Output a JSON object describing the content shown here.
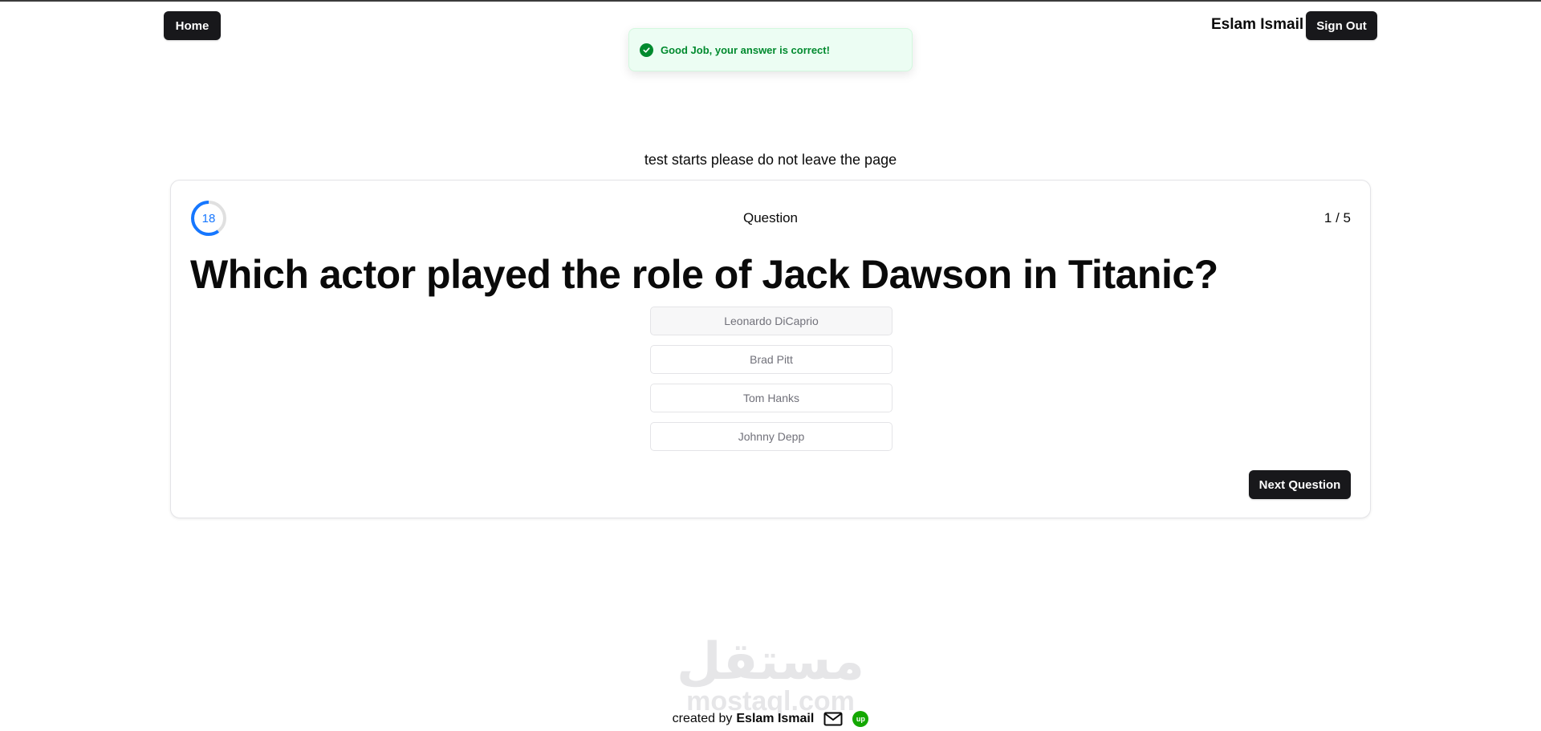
{
  "header": {
    "home_label": "Home",
    "user_name": "Eslam Ismail",
    "signout_label": "Sign Out"
  },
  "toast": {
    "icon": "check-circle-icon",
    "message": "Good Job, your answer is correct!",
    "color": "#008a2e"
  },
  "notice": "test starts please do not leave the page",
  "quiz": {
    "timer": {
      "seconds_left": "18",
      "total_seconds": 30,
      "color": "#1677ff"
    },
    "label": "Question",
    "counter": "1 / 5",
    "question": "Which actor played the role of Jack Dawson in Titanic?",
    "options": [
      {
        "label": "Leonardo DiCaprio",
        "selected": true
      },
      {
        "label": "Brad Pitt",
        "selected": false
      },
      {
        "label": "Tom Hanks",
        "selected": false
      },
      {
        "label": "Johnny Depp",
        "selected": false
      }
    ],
    "next_label": "Next Question"
  },
  "watermark": {
    "arabic": "مستقل",
    "latin": "mostaql.com"
  },
  "footer": {
    "created_by": "created by",
    "author": "Eslam Ismail",
    "mail_icon": "mail-icon",
    "upwork_icon": "upwork-icon",
    "upwork_text": "up"
  }
}
